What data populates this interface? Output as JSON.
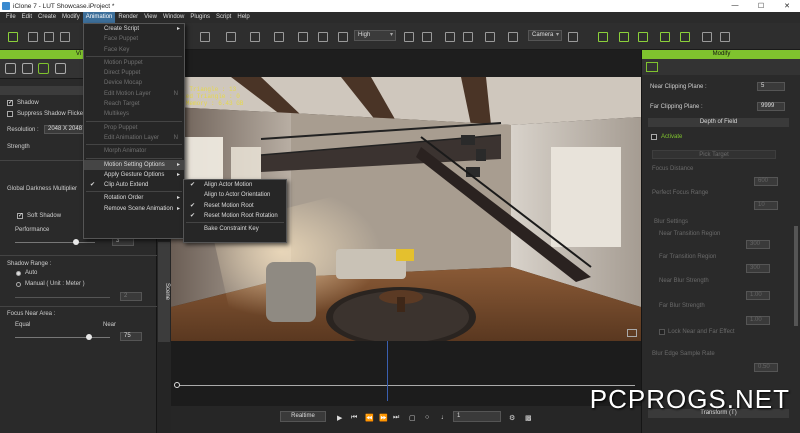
{
  "window": {
    "title": "iClone 7 - LUT Showcase.iProject *",
    "controls": [
      "—",
      "☐",
      "✕"
    ]
  },
  "menubar": [
    "File",
    "Edit",
    "Create",
    "Modify",
    "Animation",
    "Render",
    "View",
    "Window",
    "Plugins",
    "Script",
    "Help"
  ],
  "toolbar": {
    "quality": "High",
    "camera": "Camera"
  },
  "left_panel": {
    "header": "Vi",
    "section": "Shad",
    "shadow_label": "Shadow",
    "suppress_label": "Suppress Shadow Flicke",
    "resolution_label": "Resolution :",
    "resolution_value": "2048 X 2048",
    "strength_label": "Strength",
    "global_darkness_label": "Global Darkness Multiplier",
    "soft_shadow_label": "Soft Shadow",
    "performance_label": "Performance",
    "performance_value": "3",
    "shadow_range_label": "Shadow Range :",
    "auto_label": "Auto",
    "manual_label": "Manual ( Unit : Meter )",
    "manual_value": "2",
    "focus_near_label": "Focus Near Area :",
    "equal_label": "Equal",
    "near_label": "Near",
    "focus_value": "75"
  },
  "viewport": {
    "stats": [
      "ect Triangle : 13",
      "ected Triangle : 0",
      "eo Memory : 6.43 GB"
    ],
    "vtab_label": "Scene"
  },
  "animation_menu": {
    "items": [
      {
        "label": "Create Script",
        "arrow": true
      },
      {
        "label": "Face Puppet",
        "disabled": true
      },
      {
        "label": "Face Key",
        "disabled": true
      },
      {
        "sep": true
      },
      {
        "label": "Motion Puppet",
        "disabled": true
      },
      {
        "label": "Direct Puppet",
        "disabled": true
      },
      {
        "label": "Device Mocap",
        "disabled": true
      },
      {
        "label": "Edit Motion Layer",
        "disabled": true,
        "shortcut": "N"
      },
      {
        "label": "Reach Target",
        "disabled": true
      },
      {
        "label": "Multikeys",
        "disabled": true
      },
      {
        "sep": true
      },
      {
        "label": "Prop Puppet",
        "disabled": true
      },
      {
        "label": "Edit Animation Layer",
        "disabled": true,
        "shortcut": "N"
      },
      {
        "sep": true
      },
      {
        "label": "Morph Animator",
        "disabled": true
      },
      {
        "sep": true
      },
      {
        "label": "Motion Setting Options",
        "arrow": true,
        "highlight": true
      },
      {
        "label": "Apply Gesture Options",
        "arrow": true
      },
      {
        "label": "Clip Auto Extend",
        "check": true
      },
      {
        "sep": true
      },
      {
        "label": "Rotation Order",
        "arrow": true
      },
      {
        "label": "Remove Scene Animation",
        "arrow": true
      }
    ]
  },
  "motion_submenu": {
    "items": [
      {
        "label": "Align Actor Motion",
        "check": true
      },
      {
        "label": "Align to Actor Orientation"
      },
      {
        "label": "Reset Motion Root",
        "check": true
      },
      {
        "label": "Reset Motion Root Rotation",
        "check": true
      },
      {
        "sep": true
      },
      {
        "label": "Bake Constraint Key"
      }
    ]
  },
  "right_panel": {
    "header": "Modify",
    "near_clip_label": "Near Clipping Plane :",
    "near_clip_value": "5",
    "far_clip_label": "Far Clipping Plane :",
    "far_clip_value": "9999",
    "dof_section": "Depth of Field",
    "activate_label": "Activate",
    "pick_target": "Pick Target",
    "focus_distance": "Focus Distance",
    "focus_distance_value": "600",
    "perfect_focus_range": "Perfect Focus Range",
    "perfect_focus_value": "10",
    "blur_settings": "Blur Settings",
    "near_transition": "Near Transition Region",
    "near_transition_value": "300",
    "far_transition": "Far Transition Region",
    "far_transition_value": "300",
    "near_blur": "Near Blur Strength",
    "near_blur_value": "1.00",
    "far_blur": "Far Blur Strength",
    "far_blur_value": "1.00",
    "lock_label": "Lock Near and Far Effect",
    "edge_label": "Blur Edge Sample Rate",
    "edge_value": "0.50",
    "bottom_section": "Transform (T)"
  },
  "playbar": {
    "realtime": "Realtime",
    "frame": "1"
  },
  "watermark": "PCPROGS.NET",
  "colors": {
    "accent_green": "#7fc32e",
    "menu_highlight": "#3d6f9a",
    "stats_yellow": "#e6d84a"
  }
}
